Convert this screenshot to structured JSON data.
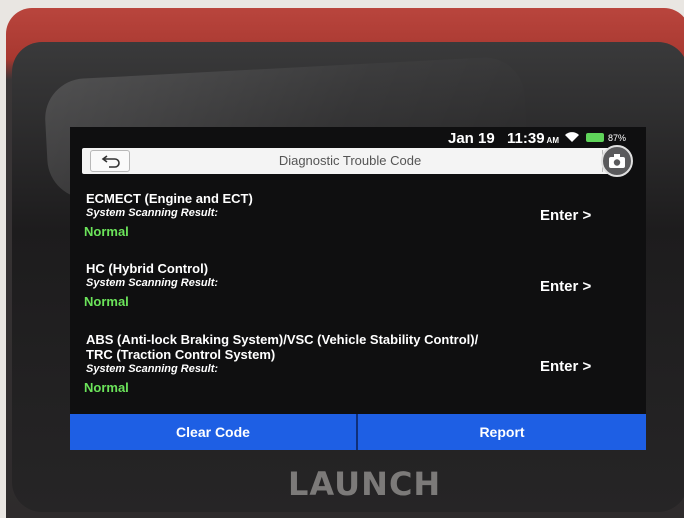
{
  "status": {
    "date": "Jan 19",
    "time": "11:39",
    "ampm": "AM",
    "battery": "87%"
  },
  "header": {
    "title": "Diagnostic Trouble Code"
  },
  "systems": [
    {
      "name_line1": "ECMECT (Engine and ECT)",
      "name_line2": "",
      "scan_label": "System Scanning Result:",
      "result": "Normal",
      "enter": "Enter >"
    },
    {
      "name_line1": "HC (Hybrid Control)",
      "name_line2": "",
      "scan_label": "System Scanning Result:",
      "result": "Normal",
      "enter": "Enter >"
    },
    {
      "name_line1": "ABS (Anti-lock Braking System)/VSC (Vehicle Stability Control)/",
      "name_line2": "TRC (Traction Control System)",
      "scan_label": "System Scanning Result:",
      "result": "Normal",
      "enter": "Enter >"
    }
  ],
  "footer": {
    "clear_code": "Clear Code",
    "report": "Report"
  },
  "brand": "LAUNCH",
  "colors": {
    "accent": "#1e5fe4",
    "normal": "#6be35a",
    "device": "#a83830"
  }
}
